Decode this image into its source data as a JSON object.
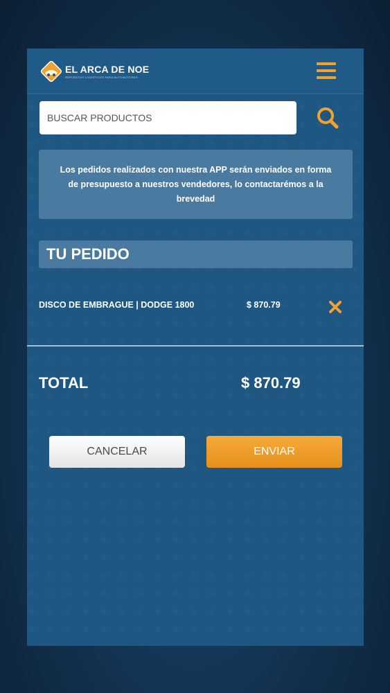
{
  "header": {
    "logo_title": "EL ARCA DE NOE",
    "logo_subtitle": "REPUESTOS LOGÍSTICOS PARA AUTOMOTORES",
    "menu_icon": "hamburger-menu-icon"
  },
  "search": {
    "placeholder": "BUSCAR PRODUCTOS",
    "value": "",
    "icon": "search-icon"
  },
  "notice": {
    "text": "Los pedidos realizados con nuestra APP serán enviados en forma de presupuesto a nuestros vendedores, lo contactarémos a la brevedad"
  },
  "order": {
    "title": "TU PEDIDO",
    "items": [
      {
        "name": "DISCO DE EMBRAGUE | DODGE 1800",
        "price": "$ 870.79",
        "remove_icon": "close-icon"
      }
    ],
    "total_label": "TOTAL",
    "total_value": "$ 870.79"
  },
  "actions": {
    "cancel_label": "CANCELAR",
    "send_label": "ENVIAR"
  },
  "colors": {
    "accent": "#f0a230",
    "panel": "#1f5783",
    "box": "#4a7aa0",
    "background": "#12314f"
  }
}
